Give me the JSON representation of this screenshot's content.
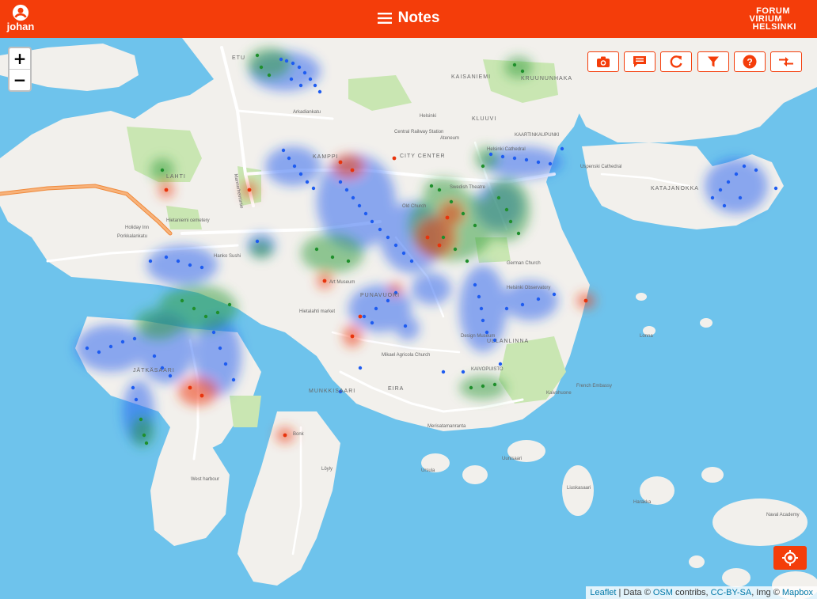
{
  "header": {
    "user_name": "johan",
    "title": "Notes",
    "logo_line1": "FORUM",
    "logo_line2": "VIRIUM",
    "logo_line3": "HELSINKI"
  },
  "zoom": {
    "in_label": "+",
    "out_label": "−"
  },
  "toolbar": [
    {
      "name": "camera-button",
      "icon": "camera-icon"
    },
    {
      "name": "comment-button",
      "icon": "comment-icon"
    },
    {
      "name": "refresh-button",
      "icon": "refresh-icon"
    },
    {
      "name": "filter-button",
      "icon": "filter-icon"
    },
    {
      "name": "help-button",
      "icon": "help-icon"
    },
    {
      "name": "compare-button",
      "icon": "arrows-compare-icon"
    }
  ],
  "colors": {
    "brand": "#f43d0a",
    "water": "#6ec3ec",
    "land": "#f2f0ec",
    "park": "#c8e6b0",
    "note_blue": "#1e5cf0",
    "note_green": "#1f8f2c",
    "note_red": "#e8340c"
  },
  "map_labels": {
    "district_kamppi": "KAMPPI",
    "district_katajanokka": "KATAJANOKKA",
    "district_kaivopuisto": "KAIVOPUISTO",
    "district_kluuvi": "KLUUVI",
    "district_kaartinkaupunki": "KAARTINKAUPUNKI",
    "district_eira": "EIRA",
    "district_munkkisaari": "MUNKKISAARI",
    "district_jatkasaari": "JÄTKÄSAARI",
    "district_kruununhaka": "KRUUNUNHAKA",
    "district_kaisaniemi": "KAISANIEMI",
    "district_punavuori": "PUNAVUORI",
    "district_ullanlinna": "ULLANLINNA",
    "district_lahti": "LAHTI",
    "district_city_center": "CITY CENTER",
    "district_etu": "ETU",
    "street_mannerheimintie": "Mannerheimintie",
    "street_arkadiankatu": "Arkadiankatu",
    "street_porkkalankatu": "Porkkalankatu",
    "street_merisatamanranta": "Merisatamanranta",
    "place_helsinki_station": "Helsinki",
    "place_central_railway": "Central Railway Station",
    "place_ateneum": "Ateneum",
    "place_old_church": "Old Church",
    "place_swedish_theatre": "Swedish Theatre",
    "place_german_church": "German Church",
    "place_helsinki_cathedral": "Helsinki Cathedral",
    "place_uspenski": "Uspenski Cathedral",
    "place_observatory": "Helsinki Observatory",
    "place_mikael_agricola": "Mikael Agricola Church",
    "place_holiday_inn": "Holiday Inn",
    "place_west_harbour": "West harbour",
    "place_hietaniemi_cemetery": "Hietaniemi cemetery",
    "place_bonk": "Bonk",
    "place_sauna": "Löyly",
    "place_french_embassy": "French Embassy",
    "place_kaivohuone": "Kaivohuone",
    "place_ursula": "Ursula",
    "place_harakka": "Harakka",
    "place_naval_academy": "Naval Academy",
    "place_lonna": "Lonna",
    "place_liuskasaari": "Liuskasaari",
    "place_uunisaari": "Uunisaari",
    "place_hanko_sushi": "Hanko Sushi",
    "place_hietalahti_market": "Hietalahti market",
    "place_design_museum": "Design Museum",
    "place_art_museum": "Art Museum"
  },
  "attribution": {
    "leaflet": "Leaflet",
    "text1": " | Data © ",
    "osm": "OSM",
    "text2": " contribs, ",
    "license": "CC-BY-SA",
    "text3": ", Img © ",
    "mapbox": "Mapbox"
  }
}
